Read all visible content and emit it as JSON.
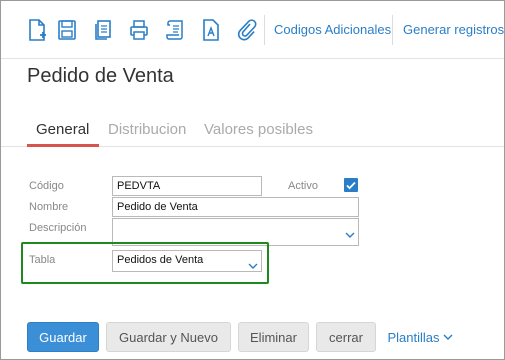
{
  "toolbar": {
    "icons": [
      "new-document-icon",
      "save-icon",
      "copy-icon",
      "print-icon",
      "scroll-icon",
      "font-document-icon",
      "attachment-icon"
    ],
    "links": {
      "codigos_adicionales": "Codigos Adicionales",
      "generar_registros": "Generar registros"
    }
  },
  "page": {
    "title": "Pedido de Venta"
  },
  "tabs": [
    "General",
    "Distribucion",
    "Valores posibles"
  ],
  "active_tab": "General",
  "form": {
    "codigo": {
      "label": "Código",
      "value": "PEDVTA"
    },
    "activo": {
      "label": "Activo",
      "checked": true
    },
    "nombre": {
      "label": "Nombre",
      "value": "Pedido de Venta"
    },
    "descripcion": {
      "label": "Descripción",
      "value": ""
    },
    "tabla": {
      "label": "Tabla",
      "value": "Pedidos de Venta"
    }
  },
  "buttons": {
    "guardar": "Guardar",
    "guardar_nuevo": "Guardar y Nuevo",
    "eliminar": "Eliminar",
    "cerrar": "cerrar",
    "plantillas": "Plantillas"
  },
  "colors": {
    "accent": "#2a7ec7",
    "tab_underline": "#d9534f",
    "highlight_border": "#1e8a1e",
    "primary_button": "#3a8fd6"
  }
}
